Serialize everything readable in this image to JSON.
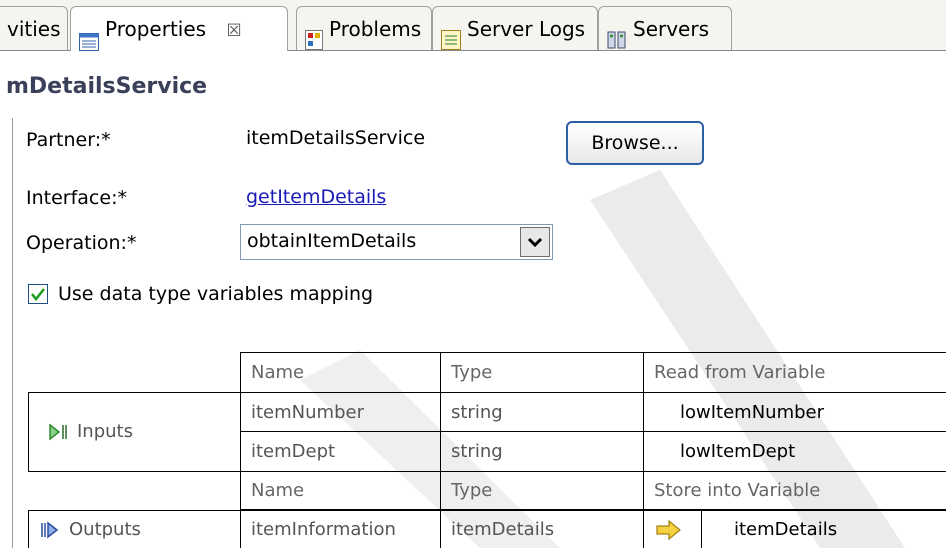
{
  "tabs": [
    {
      "label": "vities"
    },
    {
      "label": "Properties",
      "close": "☒"
    },
    {
      "label": "Problems"
    },
    {
      "label": "Server Logs"
    },
    {
      "label": "Servers"
    }
  ],
  "panel": {
    "title": "mDetailsService"
  },
  "form": {
    "partner_label": "Partner:*",
    "partner_value": "itemDetailsService",
    "browse_label": "Browse...",
    "interface_label": "Interface:*",
    "interface_value": "getItemDetails",
    "operation_label": "Operation:*",
    "operation_value": "obtainItemDetails",
    "mapping_label": "Use data type variables mapping",
    "mapping_checked": true
  },
  "inputs": {
    "section_label": "Inputs",
    "headers": [
      "Name",
      "Type",
      "Read from Variable"
    ],
    "rows": [
      {
        "name": "itemNumber",
        "type": "string",
        "variable": "lowItemNumber"
      },
      {
        "name": "itemDept",
        "type": "string",
        "variable": "lowItemDept"
      }
    ]
  },
  "outputs": {
    "section_label": "Outputs",
    "headers": [
      "Name",
      "Type",
      "Store into Variable"
    ],
    "rows": [
      {
        "name": "itemInformation",
        "type": "itemDetails",
        "variable": "itemDetails"
      }
    ]
  },
  "colors": {
    "link": "#1a1ab8",
    "button_border": "#2a5fa8",
    "arrow": "#f0c020",
    "watermark": "#e6e6e6"
  },
  "icons": [
    "properties-icon",
    "problems-icon",
    "server-logs-icon",
    "servers-icon",
    "inputs-icon",
    "outputs-icon",
    "arrow-right-icon",
    "chevron-down-icon",
    "checkmark-icon"
  ]
}
